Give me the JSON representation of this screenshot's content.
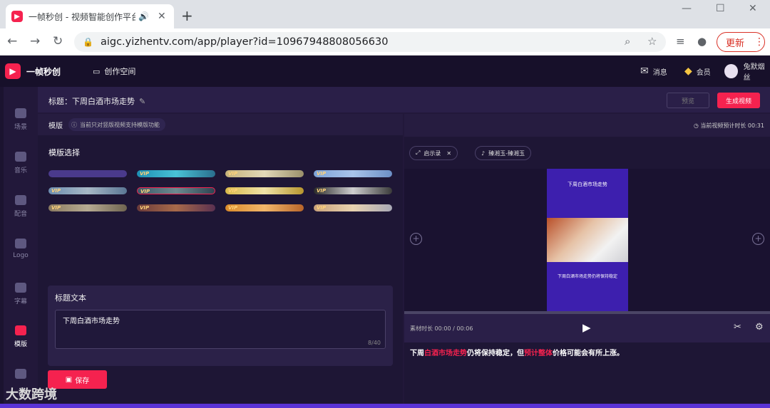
{
  "browser": {
    "tab_title": "一帧秒创 - 视频智能创作平台",
    "url": "aigc.yizhentv.com/app/player?id=10967948808056630",
    "update_label": "更新"
  },
  "header": {
    "logo_text": "一帧秒创",
    "workspace": "创作空间",
    "messages": "消息",
    "member": "会员",
    "username": "兔默烟丝"
  },
  "sidebar": {
    "items": [
      {
        "label": "场景"
      },
      {
        "label": "音乐"
      },
      {
        "label": "配音"
      },
      {
        "label": "Logo"
      },
      {
        "label": "字幕"
      },
      {
        "label": "模版"
      }
    ]
  },
  "editor": {
    "title": "标题：下周白酒市场走势",
    "preview": "预览",
    "generate": "生成视频"
  },
  "left": {
    "bar_label": "模版",
    "notice": "当前只对竖版视频支持模版功能",
    "templates_title": "模版选择",
    "vip_label": "VIP",
    "text_card_label": "标题文本",
    "text_value": "下周白酒市场走势",
    "char_count": "8/40",
    "save_label": "保存"
  },
  "right": {
    "duration": "当前视频预计时长 00:31",
    "chip_prompt": "启示录",
    "chip_voice": "臻湘玉-臻湘玉",
    "phone_title": "下周白酒市场走势",
    "phone_sub": "下周白酒市场走势仍将保持稳定",
    "clip_time": "素材时长 00:00 / 00:06",
    "subtitle_parts": [
      "下周",
      "白酒市场走势",
      "仍将保持稳定，但",
      "预计整体",
      "价格可能会有所上涨。"
    ]
  },
  "watermark": "大数跨境",
  "colors": {
    "accent": "#f5224f",
    "bg": "#1e1635",
    "panel": "#261c40"
  }
}
